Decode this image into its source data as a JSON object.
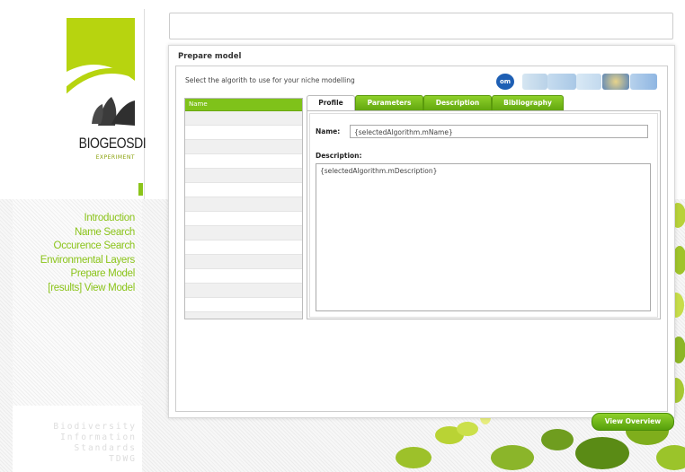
{
  "logo": {
    "title": "BIOGEOSDI",
    "subtitle": "EXPERIMENT"
  },
  "nav": {
    "items": [
      {
        "label": "Introduction"
      },
      {
        "label": "Name Search"
      },
      {
        "label": "Occurence Search"
      },
      {
        "label": "Environmental Layers"
      },
      {
        "label": "Prepare Model"
      },
      {
        "label": "[results] View Model"
      }
    ]
  },
  "footer": {
    "lines": [
      "Biodiversity",
      "Information",
      "Standards",
      "TDWG"
    ]
  },
  "panel": {
    "title": "Prepare model",
    "instruction": "Select the algorith to use for your niche modelling",
    "list_header": "Name",
    "tabs": [
      {
        "label": "Profile"
      },
      {
        "label": "Parameters"
      },
      {
        "label": "Description"
      },
      {
        "label": "Bibliography"
      }
    ],
    "profile": {
      "name_label": "Name:",
      "name_value": "{selectedAlgorithm.mName}",
      "description_label": "Description:",
      "description_value": "{selectedAlgorithm.mDescription}"
    },
    "view_overview_button": "View Overview"
  },
  "colors": {
    "accent": "#8bc41a",
    "logo_green": "#b7d40f",
    "tab_green": "#6fb615"
  }
}
